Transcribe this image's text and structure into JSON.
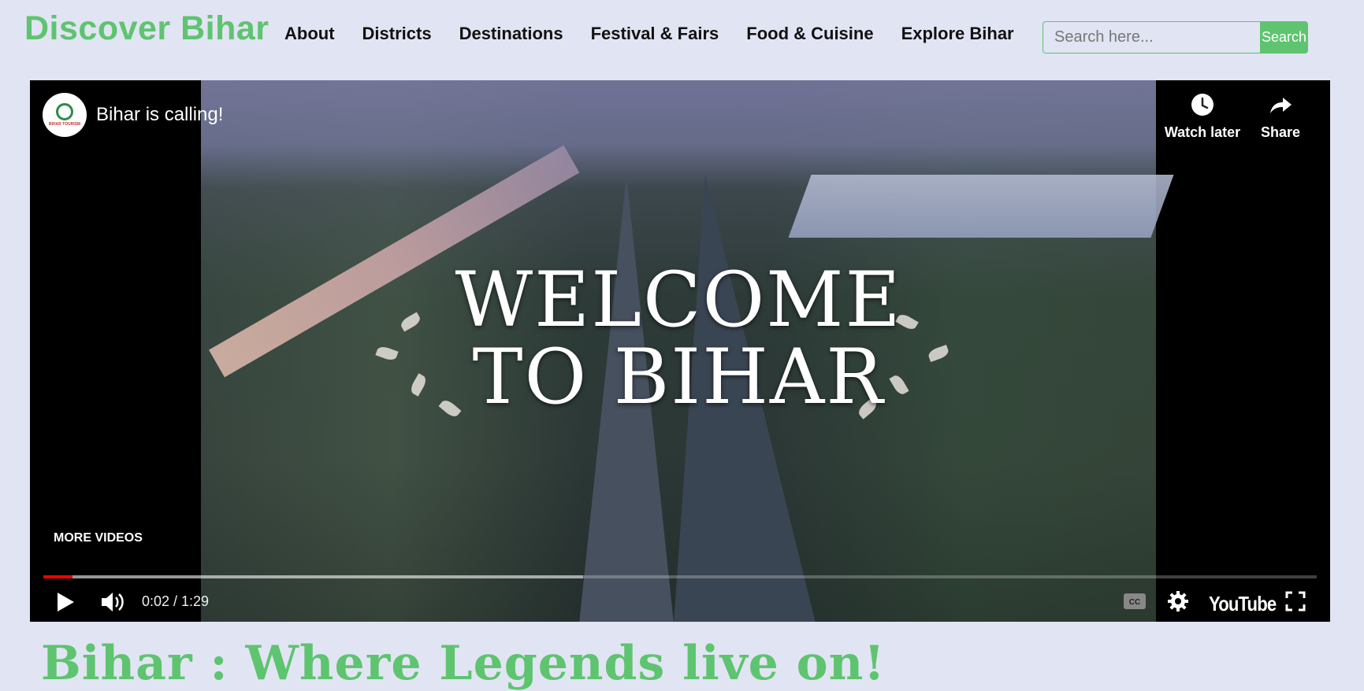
{
  "header": {
    "brand": "Discover Bihar",
    "nav": [
      "About",
      "Districts",
      "Destinations",
      "Festival & Fairs",
      "Food & Cuisine",
      "Explore Bihar"
    ],
    "search": {
      "placeholder": "Search here...",
      "button_label": "Search"
    }
  },
  "video": {
    "title": "Bihar is calling!",
    "channel_avatar_text": "BIHAR TOURISM",
    "overlay_line1": "WELCOME",
    "overlay_line2": "TO BIHAR",
    "actions": {
      "watch_later": "Watch later",
      "share": "Share"
    },
    "more_videos": "MORE VIDEOS",
    "time": "0:02 / 1:29",
    "progress_played": 0.0226,
    "progress_buffered": 0.424,
    "logo": "YouTube"
  },
  "main": {
    "headline": "Bihar : Where Legends live on!"
  },
  "colors": {
    "brand": "#5ec46f",
    "background": "#e1e4f3",
    "progress": "#ff0000"
  }
}
